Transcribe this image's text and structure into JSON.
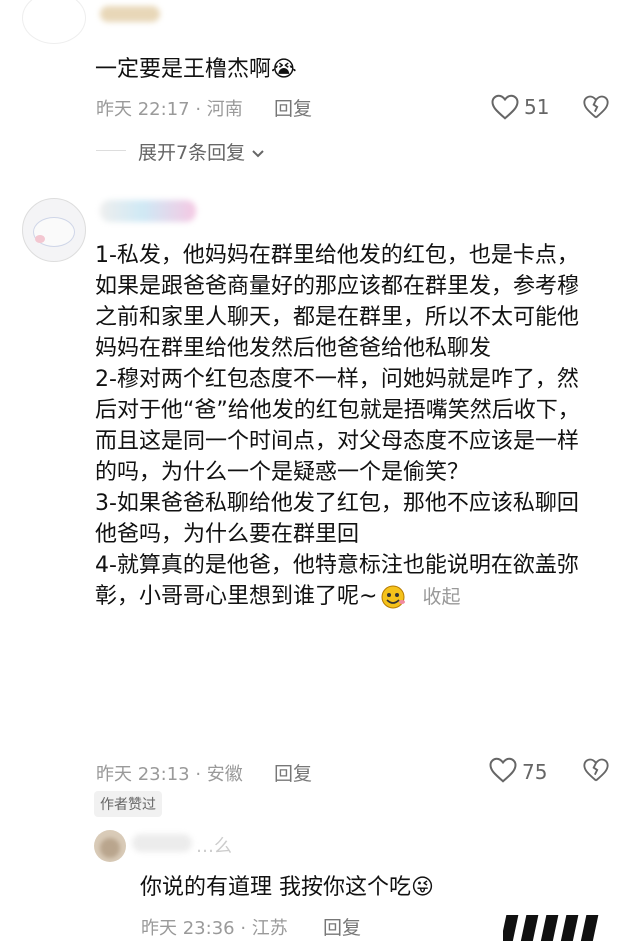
{
  "comment1": {
    "text": "一定要是王橹杰啊",
    "emoji": "😭",
    "time_location": "昨天 22:17 · 河南",
    "reply_label": "回复",
    "like_count": "51"
  },
  "expand": {
    "label": "展开7条回复"
  },
  "comment2": {
    "paragraphs": [
      "1-私发，他妈妈在群里给他发的红包，也是卡点，如果是跟爸爸商量好的那应该都在群里发，参考穆之前和家里人聊天，都是在群里，所以不太可能他妈妈在群里给他发然后他爸爸给他私聊发",
      "2-穆对两个红包态度不一样，问她妈就是咋了，然后对于他“爸”给他发的红包就是捂嘴笑然后收下，而且这是同一个时间点，对父母态度不应该是一样的吗，为什么一个是疑惑一个是偷笑？",
      "3-如果爸爸私聊给他发了红包，那他不应该私聊回他爸吗，为什么要在群里回",
      "4-就算真的是他爸，他特意标注也能说明在欲盖弥彰，小哥哥心里想到谁了呢~"
    ],
    "collapse_label": "收起",
    "time_location": "昨天 23:13 · 安徽",
    "reply_label": "回复",
    "like_count": "75",
    "author_badge": "作者赞过"
  },
  "comment3": {
    "username_partial": "…么",
    "text": "你说的有道理 我按你这个吃",
    "emoji": "😜",
    "time_location": "昨天 23:36 · 江苏",
    "reply_label": "回复"
  }
}
